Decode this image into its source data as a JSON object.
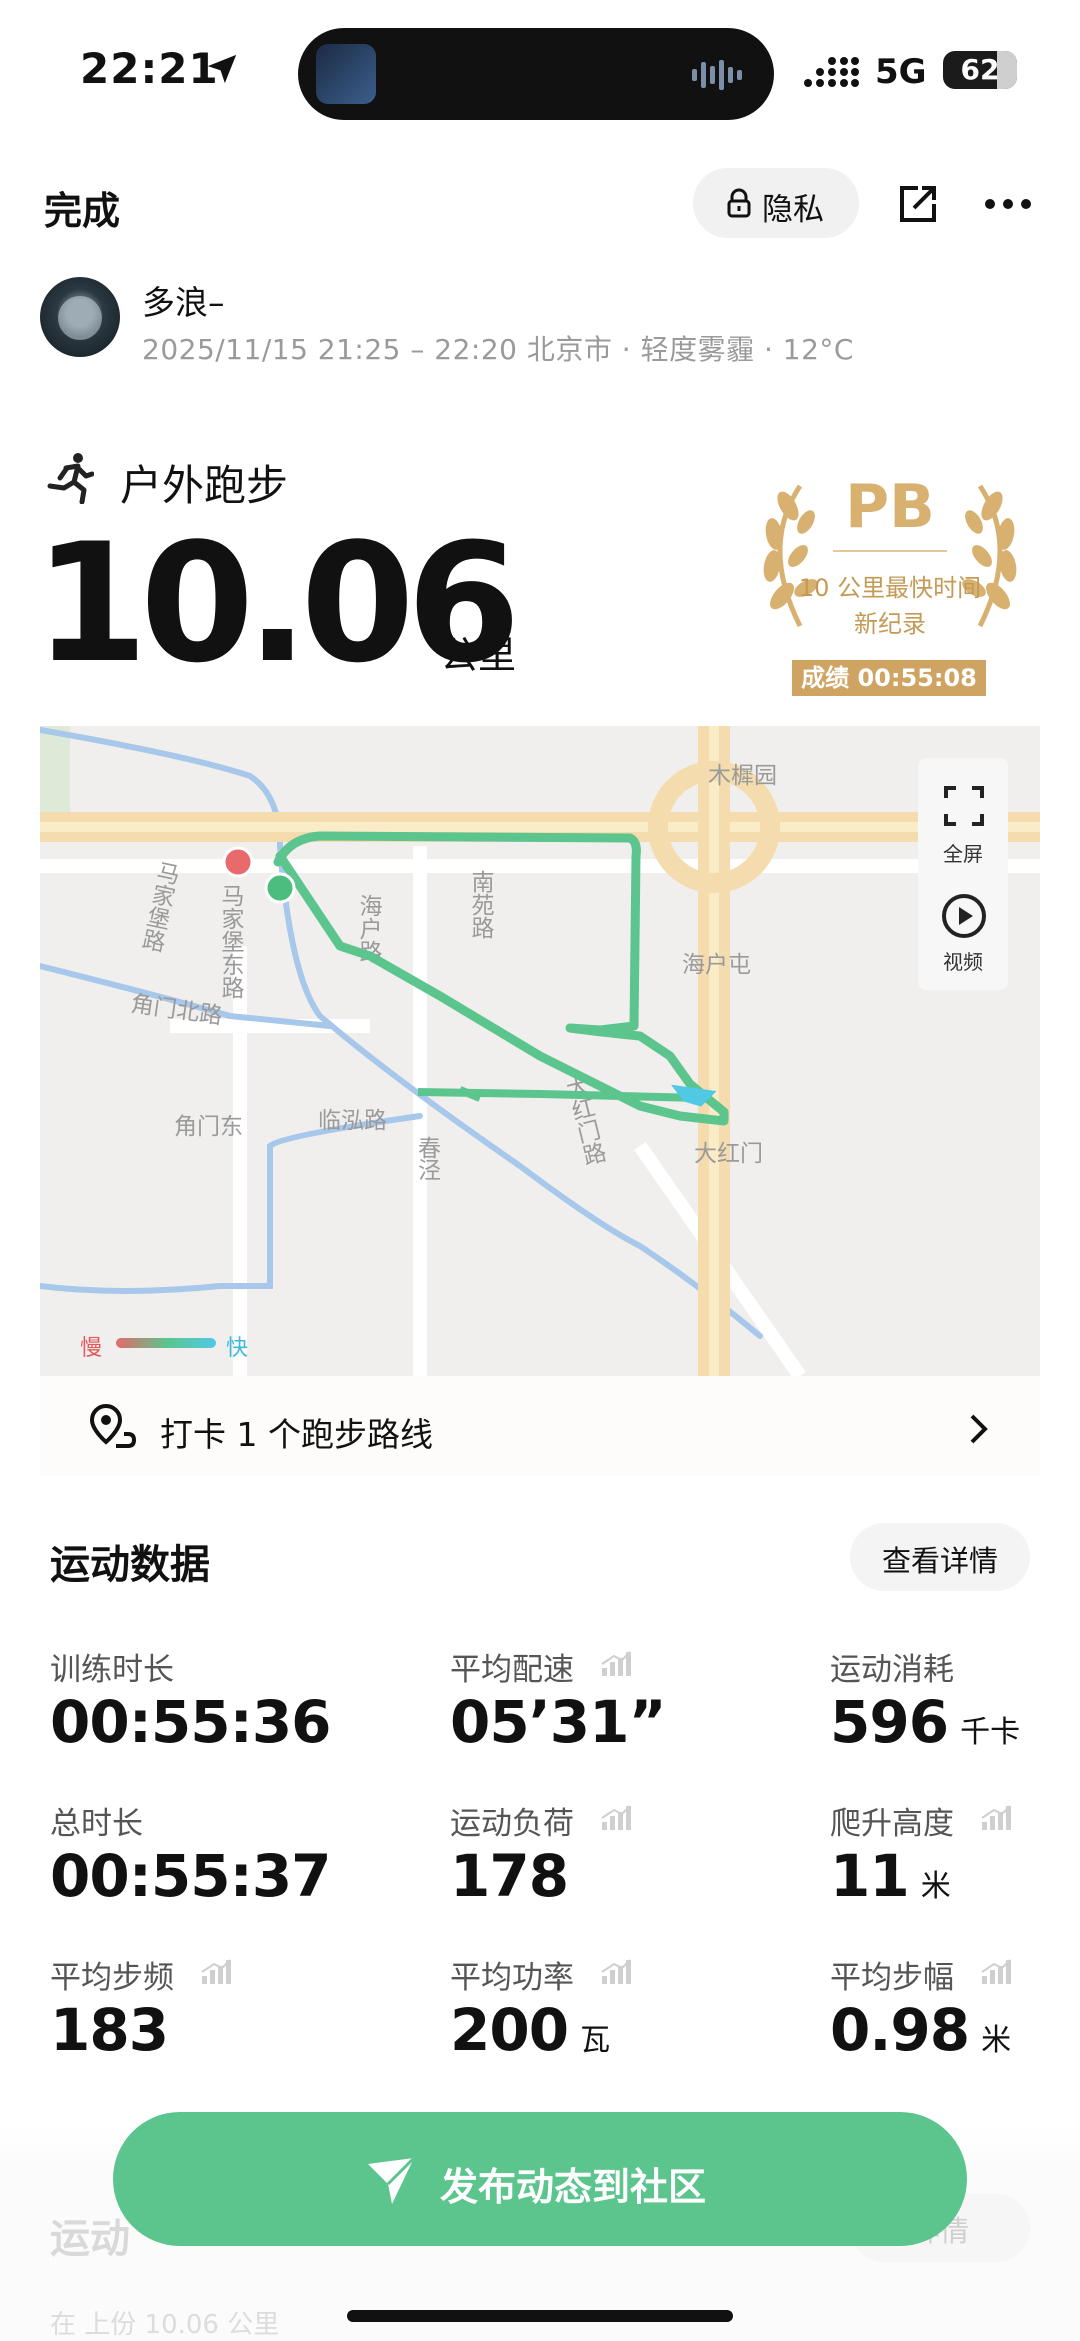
{
  "status_bar": {
    "time": "22:21",
    "network": "5G",
    "battery": "62"
  },
  "header": {
    "done_label": "完成",
    "privacy_label": "隐私"
  },
  "profile": {
    "username": "多浪–",
    "meta": "2025/11/15 21:25 – 22:20 北京市 · 轻度雾霾 · 12°C"
  },
  "activity": {
    "type": "户外跑步",
    "distance": "10.06",
    "unit": "公里"
  },
  "pb_badge": {
    "title": "PB",
    "line1": "10 公里最快时间",
    "line2": "新纪录",
    "score": "成绩 00:55:08"
  },
  "map": {
    "controls": {
      "fullscreen_label": "全屏",
      "video_label": "视频"
    },
    "labels": [
      "木樨园",
      "马家堡路",
      "马家堡东路",
      "海户路",
      "南苑路",
      "海户屯",
      "角门北路",
      "大红门路",
      "角门东",
      "临泓路",
      "春",
      "泾",
      "大红门"
    ],
    "legend": {
      "slow": "慢",
      "fast": "快"
    },
    "route_colors": {
      "main": "#5cc48d",
      "fast": "#51c9e4",
      "start": "#4cbd7e",
      "end": "#e05a5a"
    }
  },
  "checkin": {
    "text": "打卡 1 个跑步路线"
  },
  "stats": {
    "title": "运动数据",
    "details_label": "查看详情",
    "items": [
      {
        "label": "训练时长",
        "value": "00:55:36",
        "unit": ""
      },
      {
        "label": "平均配速",
        "value": "05’31”",
        "unit": ""
      },
      {
        "label": "运动消耗",
        "value": "596",
        "unit": "千卡"
      },
      {
        "label": "总时长",
        "value": "00:55:37",
        "unit": ""
      },
      {
        "label": "运动负荷",
        "value": "178",
        "unit": ""
      },
      {
        "label": "爬升高度",
        "value": "11",
        "unit": "米"
      },
      {
        "label": "平均步频",
        "value": "183",
        "unit": ""
      },
      {
        "label": "平均功率",
        "value": "200",
        "unit": "瓦"
      },
      {
        "label": "平均步幅",
        "value": "0.98",
        "unit": "米"
      }
    ]
  },
  "next_section": {
    "title": "运动",
    "details_label": "详情",
    "subtitle": "在 上份 10.06 公里"
  },
  "post_button": {
    "label": "发布动态到社区"
  },
  "colors": {
    "accent": "#5cc48d",
    "gold": "#d8b171"
  }
}
